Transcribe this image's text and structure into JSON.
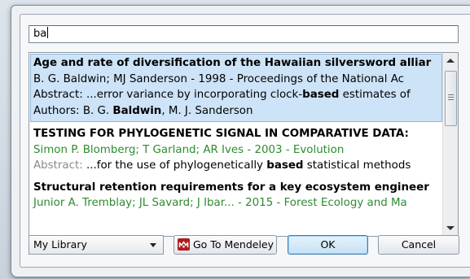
{
  "search": {
    "value": "ba"
  },
  "results": [
    {
      "title": "Age and rate of diversification of the Hawaiian silversword alliar",
      "meta": "B. G. Baldwin; MJ Sanderson - 1998 - Proceedings of the National Ac",
      "abstract_label": "Abstract: ",
      "abstract_pre": "...error variance by incorporating clock-",
      "abstract_bold": "based",
      "abstract_post": " estimates of",
      "authors_label": "Authors: B. G. ",
      "authors_bold": "Baldwin",
      "authors_post": ", M. J. Sanderson",
      "selected": true
    },
    {
      "title": "TESTING FOR PHYLOGENETIC SIGNAL IN COMPARATIVE DATA:",
      "meta": "Simon P. Blomberg; T Garland; AR Ives - 2003 - Evolution",
      "abstract_label": "Abstract: ",
      "abstract_pre": "...for the use of phylogenetically ",
      "abstract_bold": "based",
      "abstract_post": " statistical methods"
    },
    {
      "title": "Structural retention requirements for a key ecosystem engineer",
      "meta": "Junior A. Tremblay; JL Savard; J Ibar... - 2015 - Forest Ecology and Ma"
    }
  ],
  "library_select": {
    "value": "My Library"
  },
  "buttons": {
    "mendeley": "Go To Mendeley",
    "ok": "OK",
    "cancel": "Cancel"
  },
  "icons": {
    "mendeley": "mendeley-icon",
    "scroll_up": "chevron-up-icon",
    "scroll_down": "chevron-down-icon",
    "dropdown": "chevron-down-icon"
  },
  "colors": {
    "selection": "#cde3f7",
    "meta_green": "#2e8b2e",
    "mendeley_red": "#b31b1b",
    "ok_accent": "#3c7fb1"
  }
}
